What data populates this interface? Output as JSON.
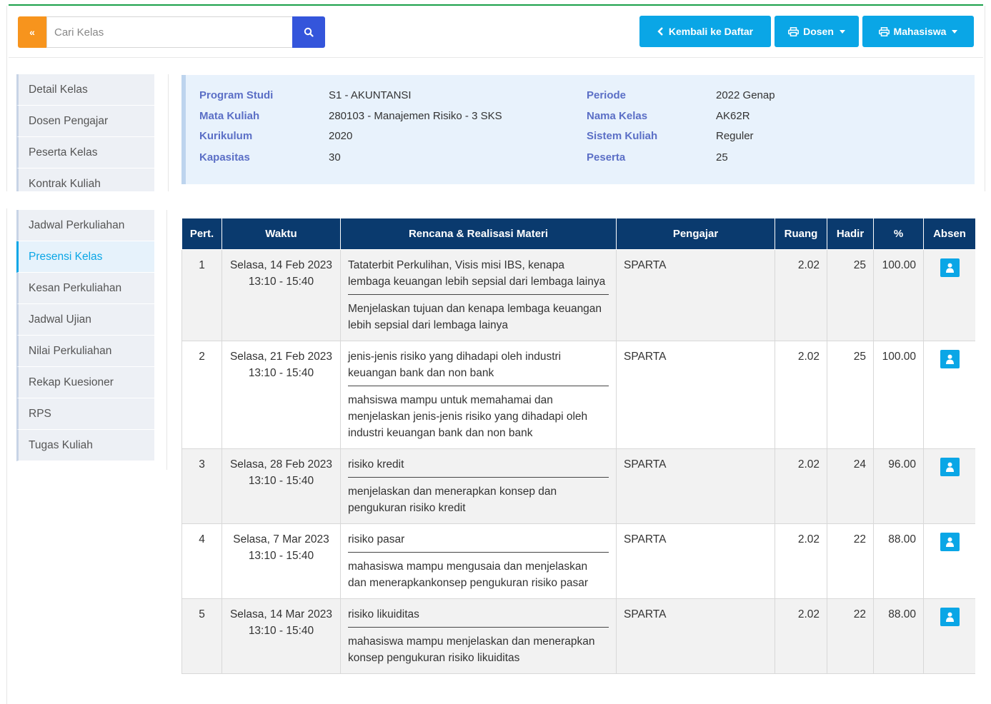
{
  "search": {
    "placeholder": "Cari Kelas",
    "collapse_glyph": "«"
  },
  "buttons": {
    "back": "Kembali ke Daftar",
    "dosen": "Dosen",
    "mahasiswa": "Mahasiswa"
  },
  "sidebar_top": [
    "Detail Kelas",
    "Dosen Pengajar",
    "Peserta Kelas",
    "Kontrak Kuliah"
  ],
  "sidebar_bottom": [
    {
      "label": "Jadwal Perkuliahan",
      "active": false
    },
    {
      "label": "Presensi Kelas",
      "active": true
    },
    {
      "label": "Kesan Perkuliahan",
      "active": false
    },
    {
      "label": "Jadwal Ujian",
      "active": false
    },
    {
      "label": "Nilai Perkuliahan",
      "active": false
    },
    {
      "label": "Rekap Kuesioner",
      "active": false
    },
    {
      "label": "RPS",
      "active": false
    },
    {
      "label": "Tugas Kuliah",
      "active": false
    }
  ],
  "info": {
    "program_studi_label": "Program Studi",
    "program_studi": "S1 - AKUNTANSI",
    "mata_kuliah_label": "Mata Kuliah",
    "mata_kuliah": "280103 - Manajemen Risiko - 3 SKS",
    "kurikulum_label": "Kurikulum",
    "kurikulum": "2020",
    "kapasitas_label": "Kapasitas",
    "kapasitas": "30",
    "periode_label": "Periode",
    "periode": "2022 Genap",
    "nama_kelas_label": "Nama Kelas",
    "nama_kelas": "AK62R",
    "sistem_kuliah_label": "Sistem Kuliah",
    "sistem_kuliah": "Reguler",
    "peserta_label": "Peserta",
    "peserta": "25"
  },
  "table": {
    "headers": [
      "Pert.",
      "Waktu",
      "Rencana & Realisasi Materi",
      "Pengajar",
      "Ruang",
      "Hadir",
      "%",
      "Absen"
    ],
    "rows": [
      {
        "pert": "1",
        "tanggal": "Selasa, 14 Feb 2023",
        "jam": "13:10 - 15:40",
        "rencana": "Tataterbit Perkulihan, Visis misi IBS, kenapa lembaga keuangan lebih sepsial dari lembaga lainya",
        "realisasi": "Menjelaskan tujuan dan kenapa lembaga keuangan lebih sepsial dari lembaga lainya",
        "pengajar": "SPARTA",
        "ruang": "2.02",
        "hadir": "25",
        "persen": "100.00"
      },
      {
        "pert": "2",
        "tanggal": "Selasa, 21 Feb 2023",
        "jam": "13:10 - 15:40",
        "rencana": "jenis-jenis risiko yang dihadapi oleh industri keuangan bank dan non bank",
        "realisasi": "mahsiswa mampu untuk memahamai dan menjelaskan jenis-jenis risiko yang dihadapi oleh industri keuangan bank dan non bank",
        "pengajar": "SPARTA",
        "ruang": "2.02",
        "hadir": "25",
        "persen": "100.00"
      },
      {
        "pert": "3",
        "tanggal": "Selasa, 28 Feb 2023",
        "jam": "13:10 - 15:40",
        "rencana": "risiko kredit",
        "realisasi": "menjelaskan dan menerapkan konsep dan pengukuran risiko kredit",
        "pengajar": "SPARTA",
        "ruang": "2.02",
        "hadir": "24",
        "persen": "96.00"
      },
      {
        "pert": "4",
        "tanggal": "Selasa, 7 Mar 2023",
        "jam": "13:10 - 15:40",
        "rencana": "risiko pasar",
        "realisasi": "mahasiswa mampu mengusaia dan menjelaskan dan menerapkankonsep pengukuran risiko pasar",
        "pengajar": "SPARTA",
        "ruang": "2.02",
        "hadir": "22",
        "persen": "88.00"
      },
      {
        "pert": "5",
        "tanggal": "Selasa, 14 Mar 2023",
        "jam": "13:10 - 15:40",
        "rencana": "risiko likuiditas",
        "realisasi": "mahasiswa mampu menjelaskan dan menerapkan konsep pengukuran risiko likuiditas",
        "pengajar": "SPARTA",
        "ruang": "2.02",
        "hadir": "22",
        "persen": "88.00"
      }
    ]
  },
  "colors": {
    "orange": "#f7941d",
    "blue": "#3455db",
    "cyan": "#0aa6e6",
    "navy": "#0a3a6e",
    "label_blue": "#5b6fc6",
    "green": "#1aa04a"
  }
}
